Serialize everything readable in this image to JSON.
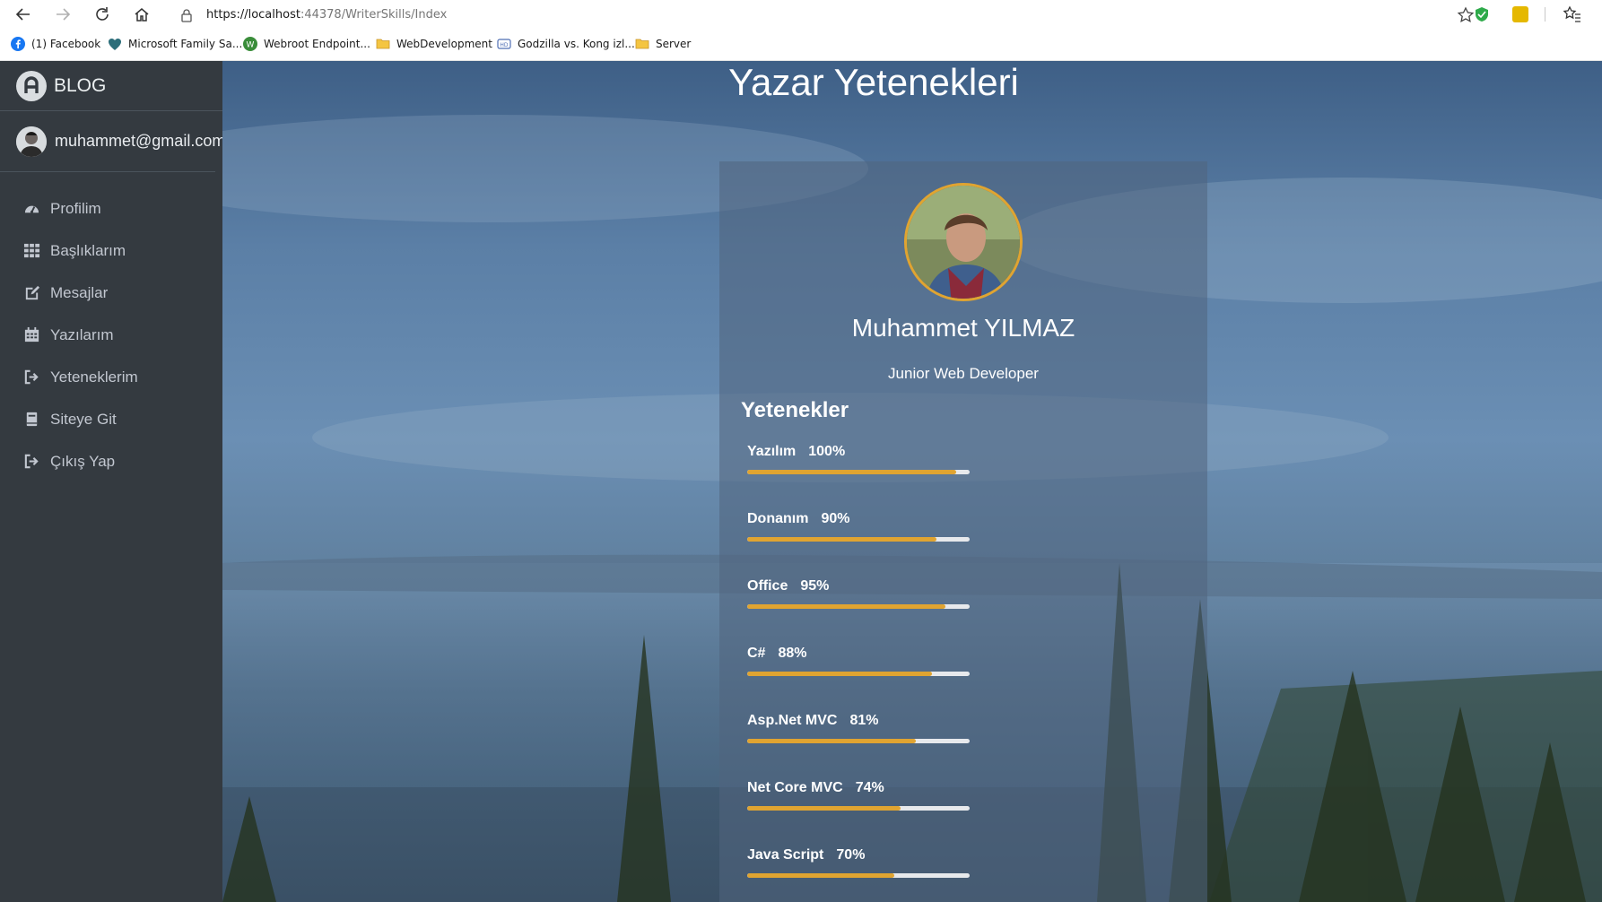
{
  "browser": {
    "url_host": "https://localhost",
    "url_rest": ":44378/WriterSkills/Index",
    "bookmarks": [
      {
        "label": "(1) Facebook",
        "icon": "facebook-icon"
      },
      {
        "label": "Microsoft Family Sa...",
        "icon": "microsoft-family-icon"
      },
      {
        "label": "Webroot Endpoint...",
        "icon": "webroot-icon"
      },
      {
        "label": "WebDevelopment",
        "icon": "folder-icon"
      },
      {
        "label": "Godzilla vs. Kong izl...",
        "icon": "hd-icon"
      },
      {
        "label": "Server",
        "icon": "folder-icon"
      }
    ]
  },
  "sidebar": {
    "brand": "BLOG",
    "user_email": "muhammet@gmail.com",
    "items": [
      {
        "label": "Profilim",
        "icon": "dashboard-icon"
      },
      {
        "label": "Başlıklarım",
        "icon": "grid-icon"
      },
      {
        "label": "Mesajlar",
        "icon": "edit-icon"
      },
      {
        "label": "Yazılarım",
        "icon": "calendar-icon"
      },
      {
        "label": "Yeteneklerim",
        "icon": "sign-out-icon"
      },
      {
        "label": "Siteye Git",
        "icon": "book-icon"
      },
      {
        "label": "Çıkış Yap",
        "icon": "sign-out-icon"
      }
    ]
  },
  "main": {
    "title": "Yazar Yetenekleri",
    "profile": {
      "name": "Muhammet YILMAZ",
      "role": "Junior Web Developer"
    },
    "skills_title": "Yetenekler",
    "skills": [
      {
        "name": "Yazılım",
        "percent_label": "100%",
        "fill": 0.94
      },
      {
        "name": "Donanım",
        "percent_label": "90%",
        "fill": 0.85
      },
      {
        "name": "Office",
        "percent_label": "95%",
        "fill": 0.89
      },
      {
        "name": "C#",
        "percent_label": "88%",
        "fill": 0.83
      },
      {
        "name": "Asp.Net MVC",
        "percent_label": "81%",
        "fill": 0.76
      },
      {
        "name": "Net Core MVC",
        "percent_label": "74%",
        "fill": 0.69
      },
      {
        "name": "Java Script",
        "percent_label": "70%",
        "fill": 0.66
      }
    ]
  },
  "colors": {
    "sidebar_bg": "#343a40",
    "accent": "#e0a431",
    "bar_track": "#e7e9ec"
  }
}
